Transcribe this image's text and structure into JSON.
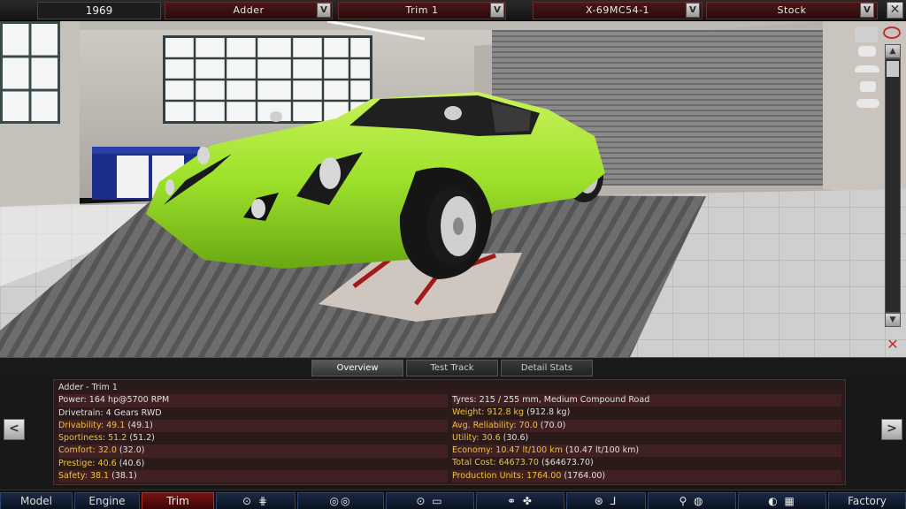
{
  "topbar": {
    "year": "1969",
    "model": "Adder",
    "trim": "Trim 1",
    "engine": "X-69MC54-1",
    "variant": "Stock",
    "dropdown_glyph": "V",
    "close_glyph": "✕"
  },
  "side_tools": {
    "icons": [
      "camera-icon",
      "eye-icon",
      "car-front-icon",
      "car-side-icon",
      "car-top-icon",
      "car-rear-icon"
    ],
    "scroll_up": "▲",
    "scroll_down": "▼",
    "paint_icon": "✕"
  },
  "tabs": [
    {
      "label": "Overview",
      "active": true
    },
    {
      "label": "Test Track",
      "active": false
    },
    {
      "label": "Detail Stats",
      "active": false
    }
  ],
  "stats": {
    "title": "Adder - Trim 1",
    "left": [
      {
        "label": "Power:",
        "value": "164 hp@5700 RPM",
        "highlight": false
      },
      {
        "label": "Drivetrain:",
        "value": "4 Gears RWD",
        "highlight": false
      },
      {
        "label": "Drivability:",
        "value": "49.1",
        "paren": "(49.1)",
        "highlight": true
      },
      {
        "label": "Sportiness:",
        "value": "51.2",
        "paren": "(51.2)",
        "highlight": true
      },
      {
        "label": "Comfort:",
        "value": "32.0",
        "paren": "(32.0)",
        "highlight": true
      },
      {
        "label": "Prestige:",
        "value": "40.6",
        "paren": "(40.6)",
        "highlight": true
      },
      {
        "label": "Safety:",
        "value": "38.1",
        "paren": "(38.1)",
        "highlight": true
      }
    ],
    "right": [
      {
        "label": "Tyres:",
        "value": "215 / 255 mm, Medium Compound Road",
        "highlight": false
      },
      {
        "label": "Weight:",
        "value": "912.8 kg",
        "paren": "(912.8 kg)",
        "highlight": true
      },
      {
        "label": "Avg. Reliability:",
        "value": "70.0",
        "paren": "(70.0)",
        "highlight": true
      },
      {
        "label": "Utility:",
        "value": "30.6",
        "paren": "(30.6)",
        "highlight": true
      },
      {
        "label": "Economy:",
        "value": "10.47 lt/100 km",
        "paren": "(10.47 lt/100 km)",
        "highlight": true
      },
      {
        "label": "Total Cost:",
        "value": "64673.70",
        "paren": "($64673.70)",
        "highlight": true
      },
      {
        "label": "Production Units:",
        "value": "1764.00",
        "paren": "(1764.00)",
        "highlight": true
      }
    ],
    "prev": "<",
    "next": ">"
  },
  "bottomnav": {
    "model": "Model",
    "engine": "Engine",
    "trim": "Trim",
    "factory": "Factory",
    "icons": [
      "chassis-icon",
      "suspension-icon",
      "body-icon",
      "car-icon",
      "fan-icon",
      "interior-icon",
      "seat-icon",
      "fixtures-icon",
      "test-drive-icon"
    ]
  },
  "colors": {
    "car": "#9de12a",
    "accent_red": "#8a1a1a",
    "highlight": "#f0c23a"
  }
}
